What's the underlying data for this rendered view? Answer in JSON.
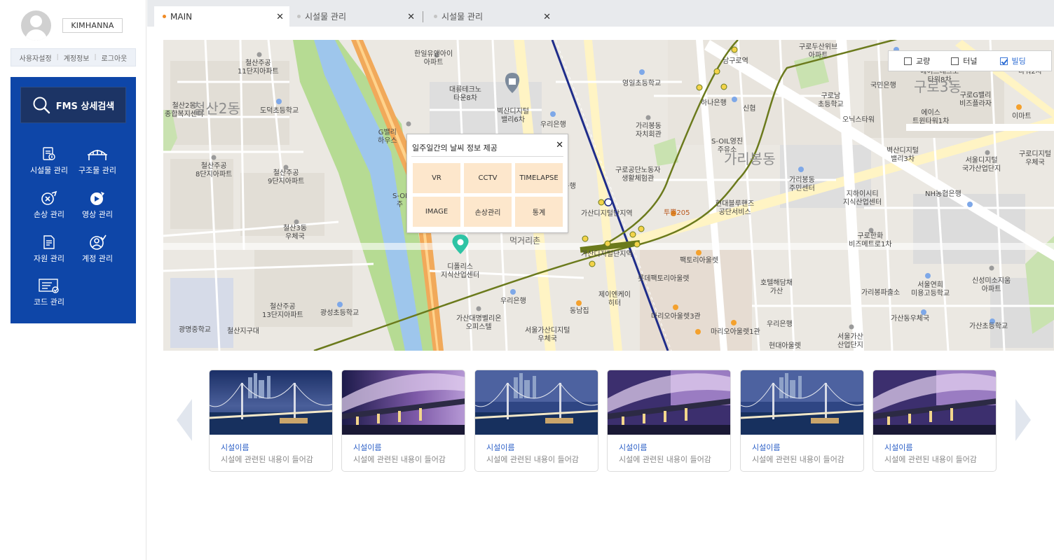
{
  "sidebar": {
    "username": "KIMHANNA",
    "user_links": [
      "사용자설정",
      "계정정보",
      "로그아웃"
    ],
    "search_button": "FMS 상세검색",
    "menu": [
      {
        "label": "시설물 관리",
        "icon": "facility-icon"
      },
      {
        "label": "구조물 관리",
        "icon": "structure-icon"
      },
      {
        "label": "손상 관리",
        "icon": "damage-icon"
      },
      {
        "label": "영상 관리",
        "icon": "video-icon"
      },
      {
        "label": "자원 관리",
        "icon": "resource-icon"
      },
      {
        "label": "계정 관리",
        "icon": "account-icon"
      },
      {
        "label": "코드 관리",
        "icon": "code-icon"
      }
    ]
  },
  "tabs": [
    {
      "label": "MAIN",
      "active": true,
      "dot_color": "#f08a24"
    },
    {
      "label": "시설물 관리",
      "active": false,
      "dot_color": "#c4c4c4"
    },
    {
      "label": "시설물 관리",
      "active": false,
      "dot_color": "#c4c4c4"
    }
  ],
  "map": {
    "filters": [
      {
        "label": "교량",
        "checked": false
      },
      {
        "label": "터널",
        "checked": false
      },
      {
        "label": "빌딩",
        "checked": true
      }
    ],
    "popup": {
      "title": "일주일간의 날씨 정보 제공",
      "buttons": [
        "VR",
        "CCTV",
        "TIMELAPSE",
        "IMAGE",
        "손상관리",
        "통계"
      ]
    },
    "labels": {
      "l1": "철산주공\n11단지아파트",
      "l2": "철산2동\n종합복지센터",
      "l3": "도덕초등학교",
      "l4": "철산주공\n8단지아파트",
      "l5": "철산주공\n9단지아파트",
      "l6": "철산3동\n우체국",
      "l7": "철산주공\n13단지아파트",
      "l8": "광성초등학교",
      "l9": "광명중학교",
      "l10": "철산지구대",
      "l11": "한일유앤아이\n아파트",
      "l12": "대륭테크노\n타운8차",
      "l13": "벽산디지털\n밸리6차",
      "l14": "우리은행",
      "l15": "G밸리\n하우스",
      "l16": "디폴리스\n지식산업센터",
      "l17": "가산대명벨리온\n오피스텔",
      "l18": "우리은행",
      "l19": "서울가산디지털\n우체국",
      "l20": "먹거리촌",
      "l21": "가산디지털단지역",
      "l22": "가산디지털단지역",
      "l23": "동남집",
      "l24": "제이엔케이\n히터",
      "l25": "영일초등학교",
      "l26": "가리봉동\n자치회관",
      "l27": "구로공단노동자\n생활체험관",
      "l28": "투뿔205",
      "l29": "현대블루핸즈\n공단서비스",
      "l30": "팩토리아울렛",
      "l31": "롯데팩토리아울렛",
      "l32": "마리오아울렛3관",
      "l33": "마리오아울렛1관",
      "l34": "남구로역",
      "l35": "하나은행",
      "l36": "신협",
      "l37": "S-OIL영진\n주유소",
      "l38": "구로두산위브\n아파트",
      "l39": "구로남\n초등학교",
      "l40": "국민은행",
      "l41": "오닉스타워",
      "l42": "에이스테크노\n타워8차",
      "l43": "에이스\n트윈타워1차",
      "l44": "구로G밸리\n비즈플라자",
      "l45": "이마트",
      "l46": "벽산디지털\n밸리3차",
      "l47": "서울디지털\n국가산업단지",
      "l48": "구로디지털\n우체국",
      "l49": "가리봉동\n주민센터",
      "l50": "지하이시티\n지식산업센터",
      "l51": "NH농협은행",
      "l52": "구로한화\n비즈메트로1차",
      "l53": "호텔해담채\n가산",
      "l54": "가리봉파출소",
      "l55": "서울연희\n미용고등학교",
      "l56": "신성미소지움\n아파트",
      "l57": "가산동우체국",
      "l58": "가산초등학교",
      "l59": "우리은행",
      "l60": "현대아울렛",
      "l61": "서울가산\n산업단지",
      "l62": "우리은행",
      "l63": "현대아울렛",
      "l64": "철산2동",
      "l65": "가리봉동",
      "l66": "구로3동",
      "l67": "타워2차",
      "l68": "국민은행",
      "l69": "S-OI\n주"
    }
  },
  "cards": [
    {
      "name": "시설이름",
      "desc": "시설에 관련된 내용이 들어감",
      "photo": "bridge-photo"
    },
    {
      "name": "시설이름",
      "desc": "시설에 관련된 내용이 들어감",
      "photo": "fountain-bridge-photo"
    },
    {
      "name": "시설이름",
      "desc": "시설에 관련된 내용이 들어감",
      "photo": "bridge-photo"
    },
    {
      "name": "시설이름",
      "desc": "시설에 관련된 내용이 들어감",
      "photo": "fountain-bridge-photo"
    },
    {
      "name": "시설이름",
      "desc": "시설에 관련된 내용이 들어감",
      "photo": "bridge-photo"
    },
    {
      "name": "시설이름",
      "desc": "시설에 관련된 내용이 들어감",
      "photo": "fountain-bridge-photo"
    }
  ],
  "colors": {
    "sidebar_panel": "#0e46a8",
    "search_button": "#1c3465",
    "popup_button": "#fde7cc",
    "card_title": "#2b5fc7",
    "pin": "#2ec4a5"
  }
}
